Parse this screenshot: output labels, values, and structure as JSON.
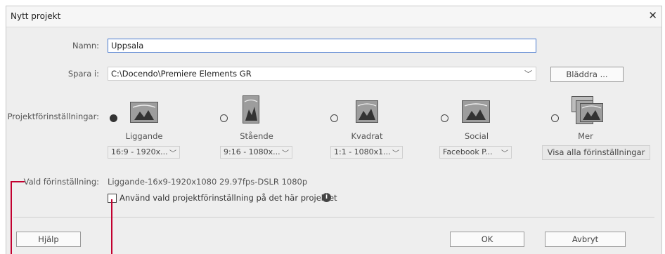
{
  "window": {
    "title": "Nytt projekt"
  },
  "form": {
    "name_label": "Namn:",
    "name_value": "Uppsala",
    "save_label": "Spara i:",
    "save_path": "C:\\Docendo\\Premiere Elements GR",
    "browse_label": "Bläddra ...",
    "settings_label": "Projektförinställningar:"
  },
  "presets": [
    {
      "name": "Liggande",
      "dropdown": "16:9 - 1920x...",
      "selected": true
    },
    {
      "name": "Stående",
      "dropdown": "9:16 - 1080x...",
      "selected": false
    },
    {
      "name": "Kvadrat",
      "dropdown": "1:1 - 1080x1...",
      "selected": false
    },
    {
      "name": "Social",
      "dropdown": "Facebook P...",
      "selected": false
    },
    {
      "name": "Mer",
      "dropdown": "Visa alla förinställningar",
      "selected": false
    }
  ],
  "selected_preset": {
    "label": "Vald förinställning:",
    "value": "Liggande-16x9-1920x1080 29.97fps-DSLR 1080p"
  },
  "checkbox": {
    "label": "Använd vald projektförinställning på det här projektet"
  },
  "buttons": {
    "help": "Hjälp",
    "ok": "OK",
    "cancel": "Avbryt"
  },
  "colors": {
    "accent": "#4a7bd0",
    "callout": "#c2002f",
    "dialog_bg": "#eeeeee"
  },
  "icons": {
    "close": "close-icon",
    "info": "info-icon",
    "chevron": "chevron-down-icon"
  }
}
